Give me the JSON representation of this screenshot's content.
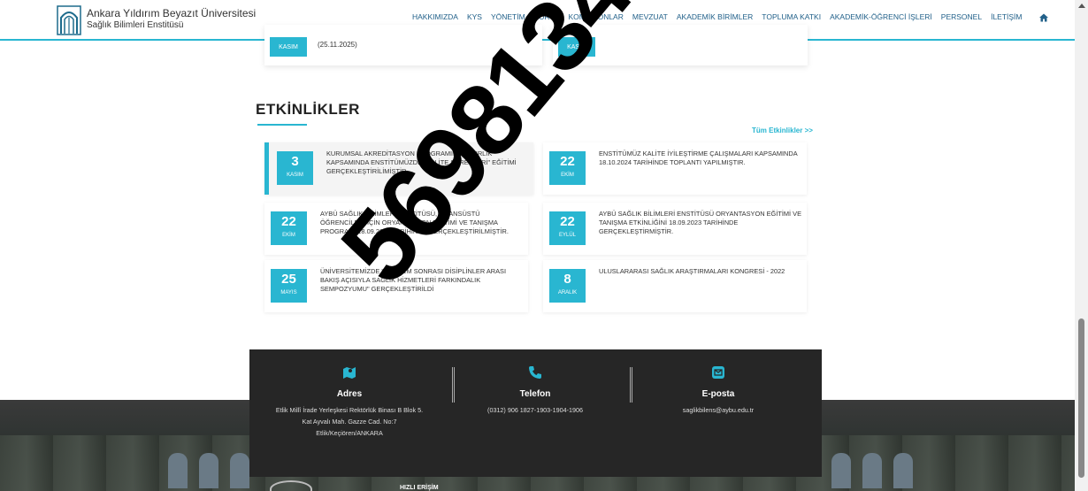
{
  "header": {
    "university": "Ankara Yıldırım Beyazıt Üniversitesi",
    "institute": "Sağlık Bilimleri Enstitüsü",
    "nav": [
      "HAKKIMIZDA",
      "KYS",
      "YÖNETİM",
      "KURUL",
      "KOMİSYONLAR",
      "MEVZUAT",
      "AKADEMİK BİRİMLER",
      "TOPLUMA KATKI",
      "AKADEMİK-ÖĞRENCİ İŞLERİ",
      "PERSONEL",
      "İLETİŞİM"
    ]
  },
  "top_cards": [
    {
      "month": "KASIM",
      "text": "(25.11.2025)"
    },
    {
      "month": "KASIM",
      "text": ""
    }
  ],
  "events": {
    "title": "ETKİNLİKLER",
    "all_link": "Tüm Etkinlikler >>",
    "items": [
      {
        "day": "3",
        "month": "KASIM",
        "text": "KURUMSAL AKREDİTASYON PROGRAMINA HAZIRLIK KAPSAMINDA ENSTİTÜMÜZDE \"KALİTE SÜREÇLERİ\" EĞİTİMİ GERÇEKLEŞTİRİLİMİŞTİR."
      },
      {
        "day": "22",
        "month": "EKİM",
        "text": "ENSTİTÜMÜZ KALİTE İYİLEŞTİRME ÇALIŞMALARI KAPSAMINDA 18.10.2024 TARİHİNDE TOPLANTI YAPILMIŞTIR."
      },
      {
        "day": "22",
        "month": "EKİM",
        "text": "AYBÜ SAĞLIK BİLİMLERİ ENSTİTÜSÜ, LİSANSÜSTÜ ÖĞRENCİLERİ İÇİN ORYANTASYON EĞİTİMİ VE TANIŞMA PROGRAMI 18.09.2024 TARİHİNDE GERÇEKLEŞTİRİLMİŞTİR."
      },
      {
        "day": "22",
        "month": "EYLÜL",
        "text": "AYBÜ SAĞLIK BİLİMLERİ ENSTİTÜSÜ ORYANTASYON EĞİTİMİ VE TANIŞMA ETKİNLİĞİNİ 18.09.2023 TARİHİNDE GERÇEKLEŞTİRMİŞTİR."
      },
      {
        "day": "25",
        "month": "MAYIS",
        "text": "ÜNİVERSİTEMİZDE \"DEPREM SONRASI DİSİPLİNLER ARASI BAKIŞ AÇISIYLA SAĞLIK HİZMETLERİ FARKINDALIK SEMPOZYUMU\" GERÇEKLEŞTİRİLDİ"
      },
      {
        "day": "8",
        "month": "ARALIK",
        "text": "ULUSLARARASI SAĞLIK ARAŞTIRMALARI KONGRESİ - 2022"
      }
    ]
  },
  "contact": {
    "address_title": "Adres",
    "address_value": "Etlik Millî İrade Yerleşkesi Rektörlük Binası B Blok 5. Kat Ayvalı Mah. Gazze Cad. No:7 Etlik/Keçiören/ANKARA",
    "phone_title": "Telefon",
    "phone_value": "(0312) 906 1827-1903-1904-1906",
    "email_title": "E-posta",
    "email_value": "saglikbilens@aybu.edu.tr"
  },
  "footer": {
    "label": "HIZLI ERİŞİM"
  },
  "watermark": "5698134",
  "colors": {
    "accent": "#29b6d1",
    "nav": "#22618a",
    "contact_bg": "#262626"
  },
  "icons": {
    "address": "map-icon",
    "phone": "phone-icon",
    "email": "envelope-icon",
    "home": "home-icon"
  }
}
